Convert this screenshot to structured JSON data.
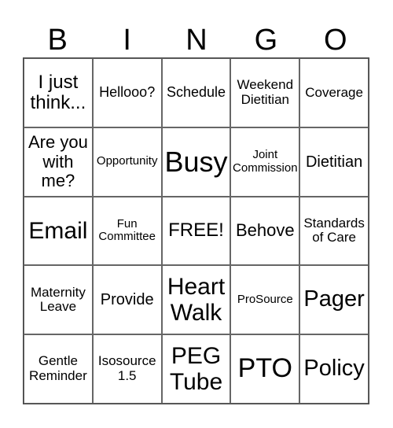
{
  "header": {
    "letters": [
      "B",
      "I",
      "N",
      "G",
      "O"
    ]
  },
  "card": {
    "rows": [
      [
        "I just think...",
        "Hellooo?",
        "Schedule",
        "Weekend Dietitian",
        "Coverage"
      ],
      [
        "Are you with me?",
        "Opportunity",
        "Busy",
        "Joint Commission",
        "Dietitian"
      ],
      [
        "Email",
        "Fun Committee",
        "FREE!",
        "Behove",
        "Standards of Care"
      ],
      [
        "Maternity Leave",
        "Provide",
        "Heart Walk",
        "ProSource",
        "Pager"
      ],
      [
        "Gentle Reminder",
        "Isosource 1.5",
        "PEG Tube",
        "PTO",
        "Policy"
      ]
    ]
  }
}
